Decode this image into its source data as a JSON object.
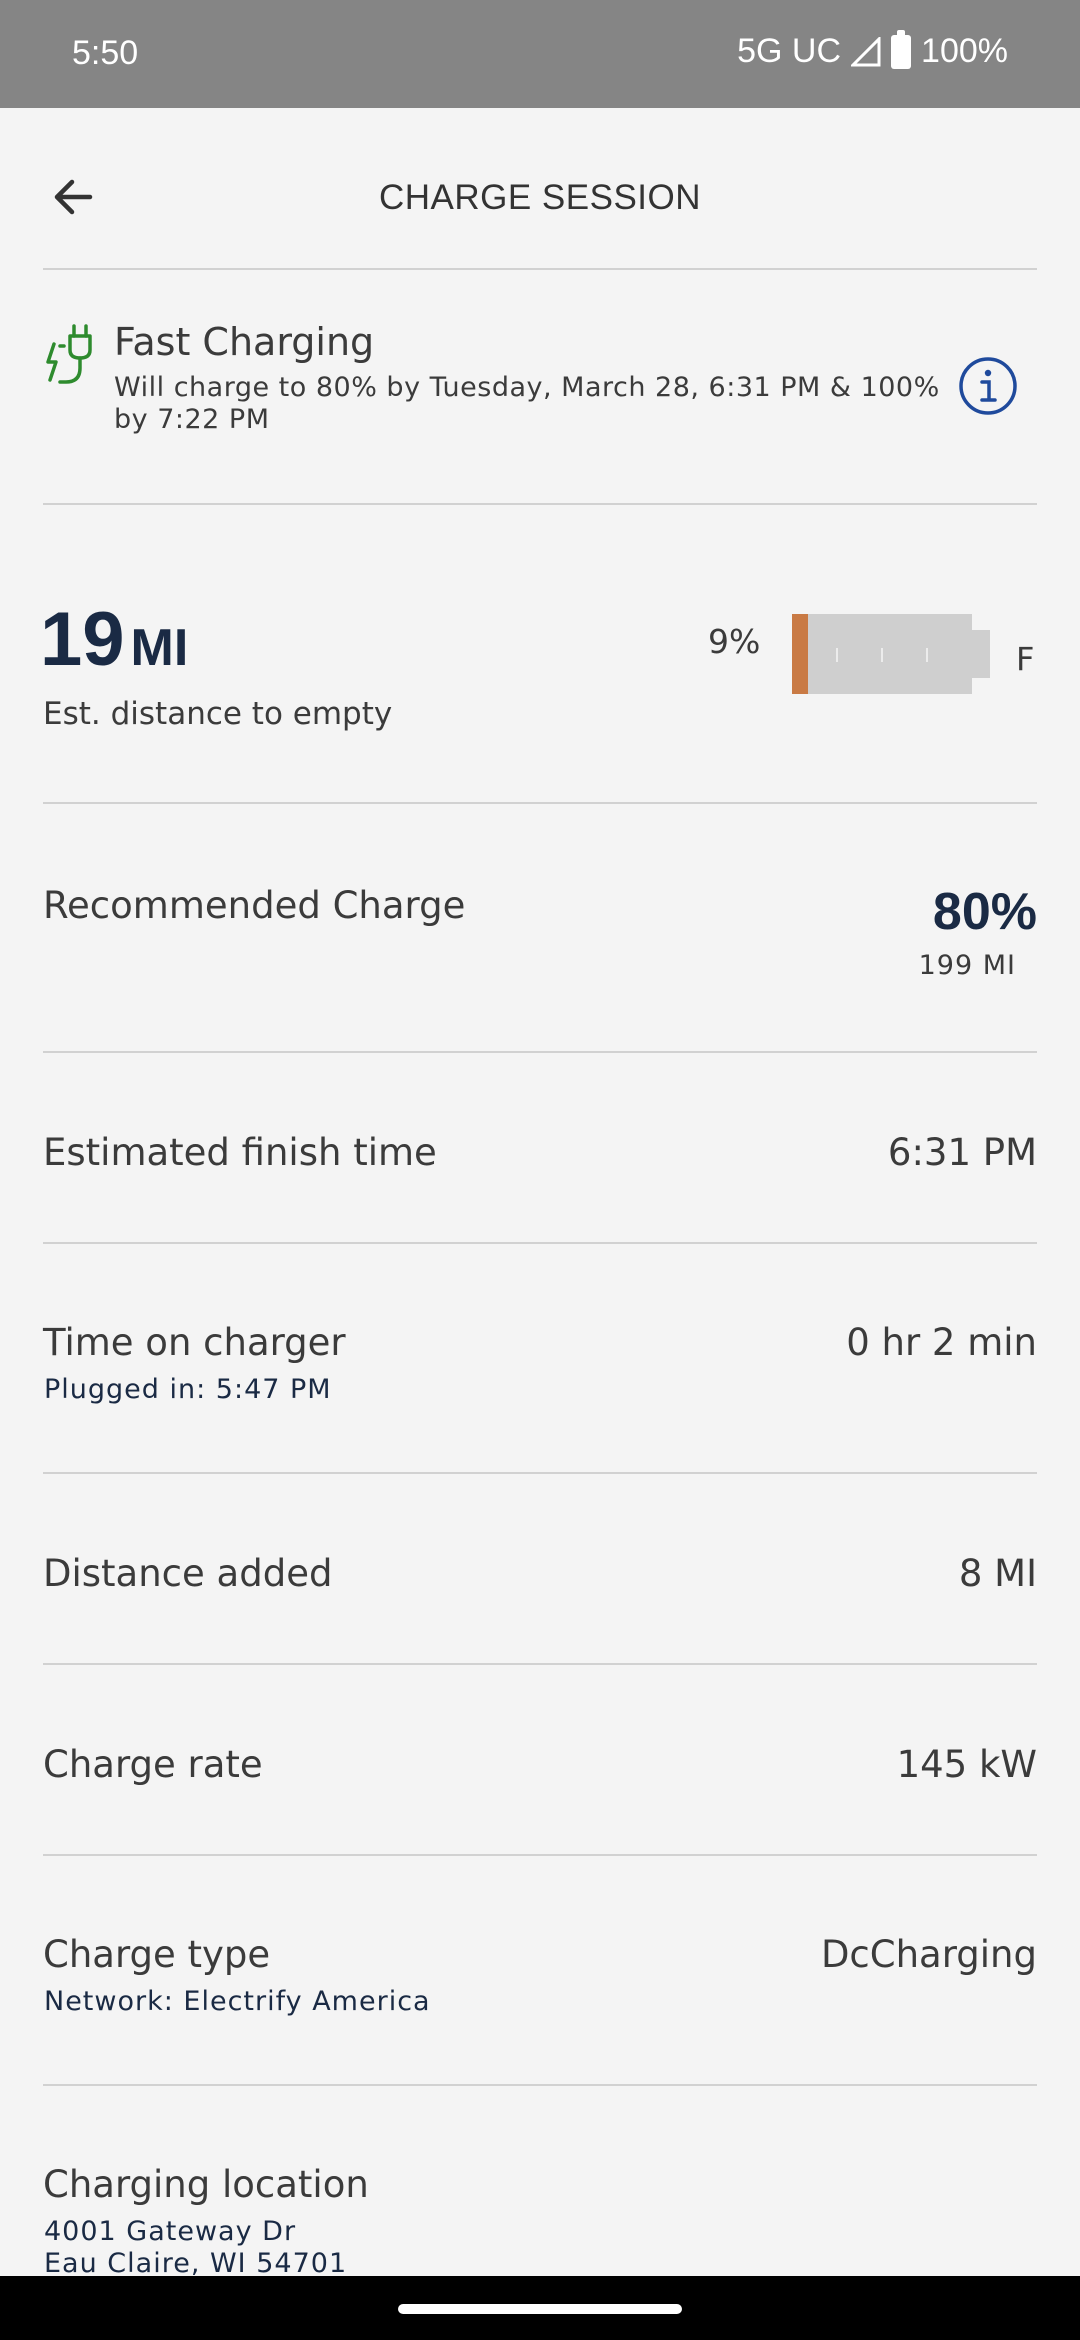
{
  "status_bar": {
    "time": "5:50",
    "network": "5G UC",
    "battery": "100%"
  },
  "header": {
    "title": "CHARGE SESSION",
    "back_icon": "arrow-left-icon"
  },
  "charging_status": {
    "icon": "ev-plug-charging-icon",
    "title": "Fast Charging",
    "description": "Will charge to 80% by Tuesday, March 28, 6:31 PM & 100% by 7:22 PM",
    "info_icon": "info-icon"
  },
  "range": {
    "value": "19",
    "unit": "MI",
    "label": "Est. distance to empty",
    "soc_percent_label": "9%",
    "soc_fraction": 0.09,
    "full_label": "F"
  },
  "recommended_charge": {
    "label": "Recommended Charge",
    "percent": "80%",
    "miles": "199 MI"
  },
  "finish_time": {
    "label": "Estimated finish time",
    "value": "6:31 PM"
  },
  "time_on_charger": {
    "label": "Time on charger",
    "sub": "Plugged in: 5:47 PM",
    "value": "0 hr 2 min"
  },
  "distance_added": {
    "label": "Distance added",
    "value": "8 MI"
  },
  "charge_rate": {
    "label": "Charge rate",
    "value": "145 kW"
  },
  "charge_type": {
    "label": "Charge type",
    "sub": "Network: Electrify America",
    "value": "DcCharging"
  },
  "charging_location": {
    "label": "Charging location",
    "address_line1": "4001 Gateway Dr",
    "address_line2": "Eau Claire, WI 54701"
  },
  "colors": {
    "accent_navy": "#1a2a44",
    "charge_green": "#2e8b2e",
    "battery_orange": "#c97a44",
    "info_blue": "#1f4a9c"
  }
}
